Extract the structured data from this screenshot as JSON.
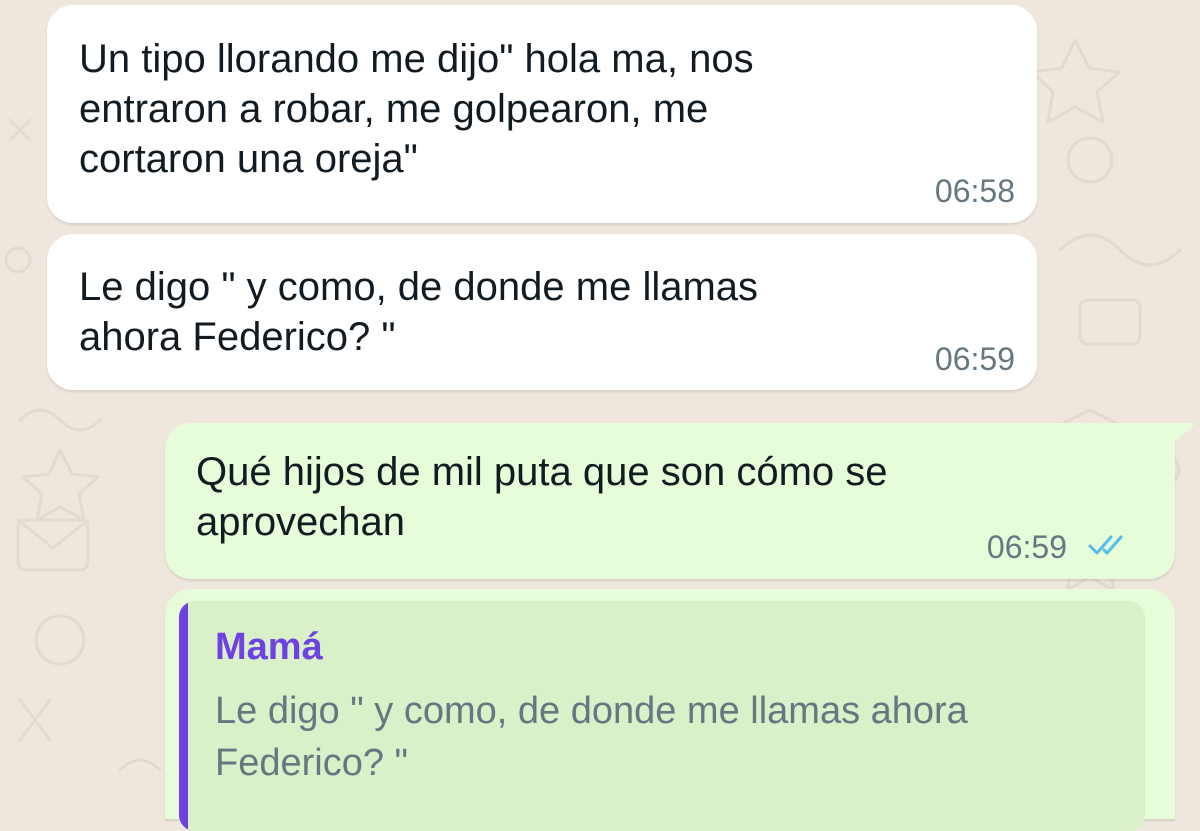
{
  "chat": {
    "messages": [
      {
        "direction": "incoming",
        "text": "Un tipo llorando me dijo\" hola ma, nos\nentraron a robar, me golpearon, me\ncortaron una oreja\"",
        "time": "06:58"
      },
      {
        "direction": "incoming",
        "text": "Le digo \" y como, de donde me llamas\nahora Federico? \"",
        "time": "06:59"
      },
      {
        "direction": "outgoing",
        "text": "Qué hijos de mil puta que son cómo se\naprovechan",
        "time": "06:59",
        "status_icon": "double-check-read-icon"
      }
    ],
    "reply_draft": {
      "quoted_author": "Mamá",
      "quoted_text": "Le digo \" y como, de donde me llamas ahora\nFederico? \""
    }
  },
  "colors": {
    "background": "#efe7de",
    "incoming_bubble": "#ffffff",
    "outgoing_bubble": "#e7fcd8",
    "quote_background": "#d9f0c9",
    "quote_accent": "#6e42e0",
    "read_ticks": "#53bdeb",
    "timestamp": "#667781"
  }
}
